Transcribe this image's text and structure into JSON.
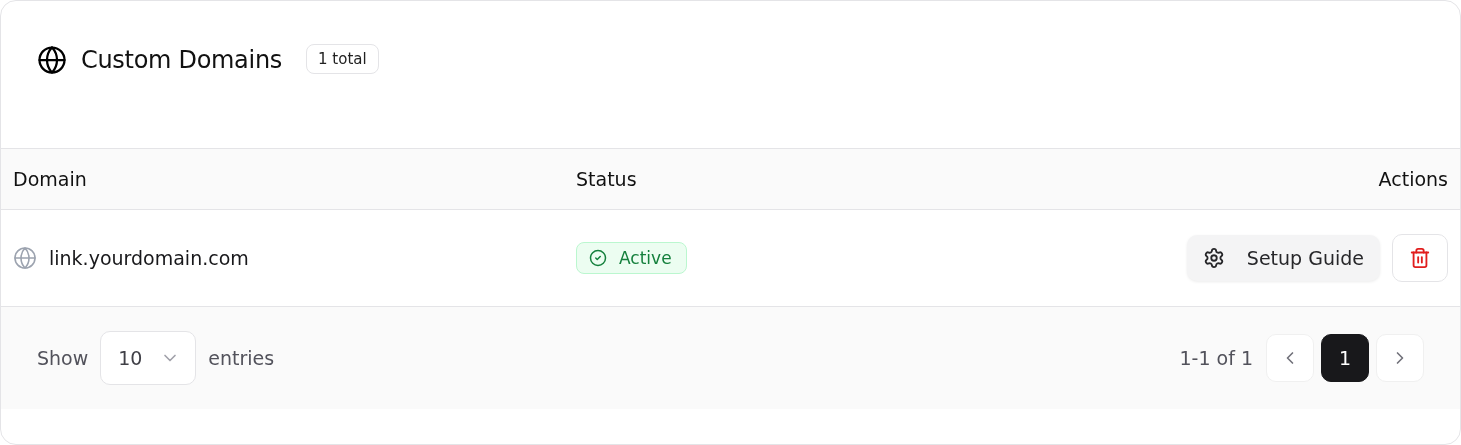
{
  "header": {
    "title": "Custom Domains",
    "count_badge": "1 total"
  },
  "table": {
    "columns": [
      "Domain",
      "Status",
      "Actions"
    ],
    "rows": [
      {
        "domain": "link.yourdomain.com",
        "status": {
          "label": "Active",
          "kind": "success"
        },
        "actions": {
          "setup_button": "Setup Guide"
        }
      }
    ]
  },
  "footer": {
    "show_label": "Show",
    "page_size": "10",
    "entries_label": "entries",
    "range": "1-1 of 1",
    "pages": [
      {
        "label": "1",
        "selected": true
      }
    ]
  }
}
